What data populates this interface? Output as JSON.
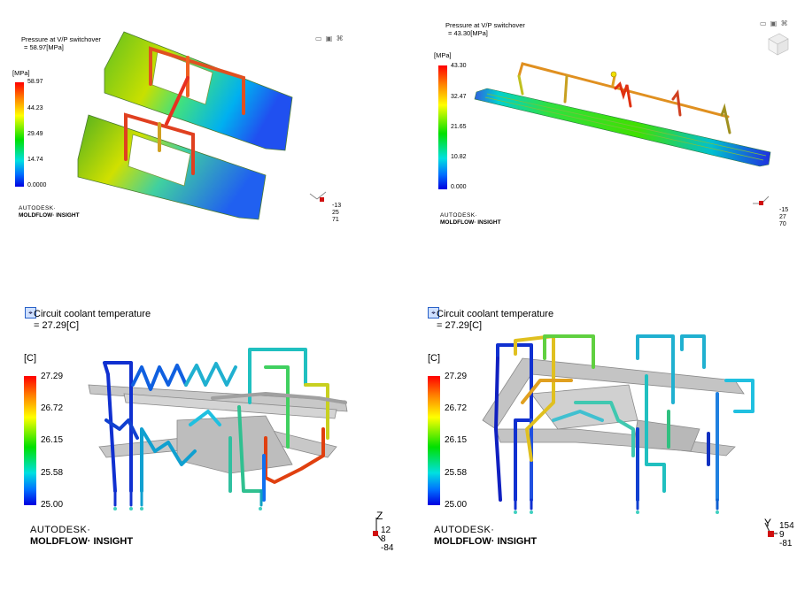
{
  "panels": [
    {
      "title_line1": "Pressure at V/P switchover",
      "title_line2": "= 58.97[MPa]",
      "unit": "[MPa]",
      "ticks": [
        "58.97",
        "44.23",
        "29.49",
        "14.74",
        "0.0000"
      ],
      "window_controls": "▭ ▣ ⌘",
      "triad_values": [
        "-13",
        "25",
        "71"
      ],
      "brand_line1": "AUTODESK·",
      "brand_line2": "MOLDFLOW· INSIGHT"
    },
    {
      "title_line1": "Pressure at V/P switchover",
      "title_line2": "= 43.30[MPa]",
      "unit": "[MPa]",
      "ticks": [
        "43.30",
        "32.47",
        "21.65",
        "10.82",
        "0.000"
      ],
      "window_controls": "▭ ▣ ⌘",
      "triad_values": [
        "-15",
        "27",
        "70"
      ],
      "brand_line1": "AUTODESK·",
      "brand_line2": "MOLDFLOW· INSIGHT"
    },
    {
      "title_line1": "Circuit coolant temperature",
      "title_line2": "= 27.29[C]",
      "unit": "[C]",
      "ticks": [
        "27.29",
        "26.72",
        "26.15",
        "25.58",
        "25.00"
      ],
      "triad_values": [
        "12",
        "8",
        "-84"
      ],
      "brand_line1": "AUTODESK·",
      "brand_line2": "MOLDFLOW· INSIGHT"
    },
    {
      "title_line1": "Circuit coolant temperature",
      "title_line2": "= 27.29[C]",
      "unit": "[C]",
      "ticks": [
        "27.29",
        "26.72",
        "26.15",
        "25.58",
        "25.00"
      ],
      "triad_values": [
        "154",
        "9",
        "-81"
      ],
      "brand_line1": "AUTODESK·",
      "brand_line2": "MOLDFLOW· INSIGHT"
    }
  ]
}
